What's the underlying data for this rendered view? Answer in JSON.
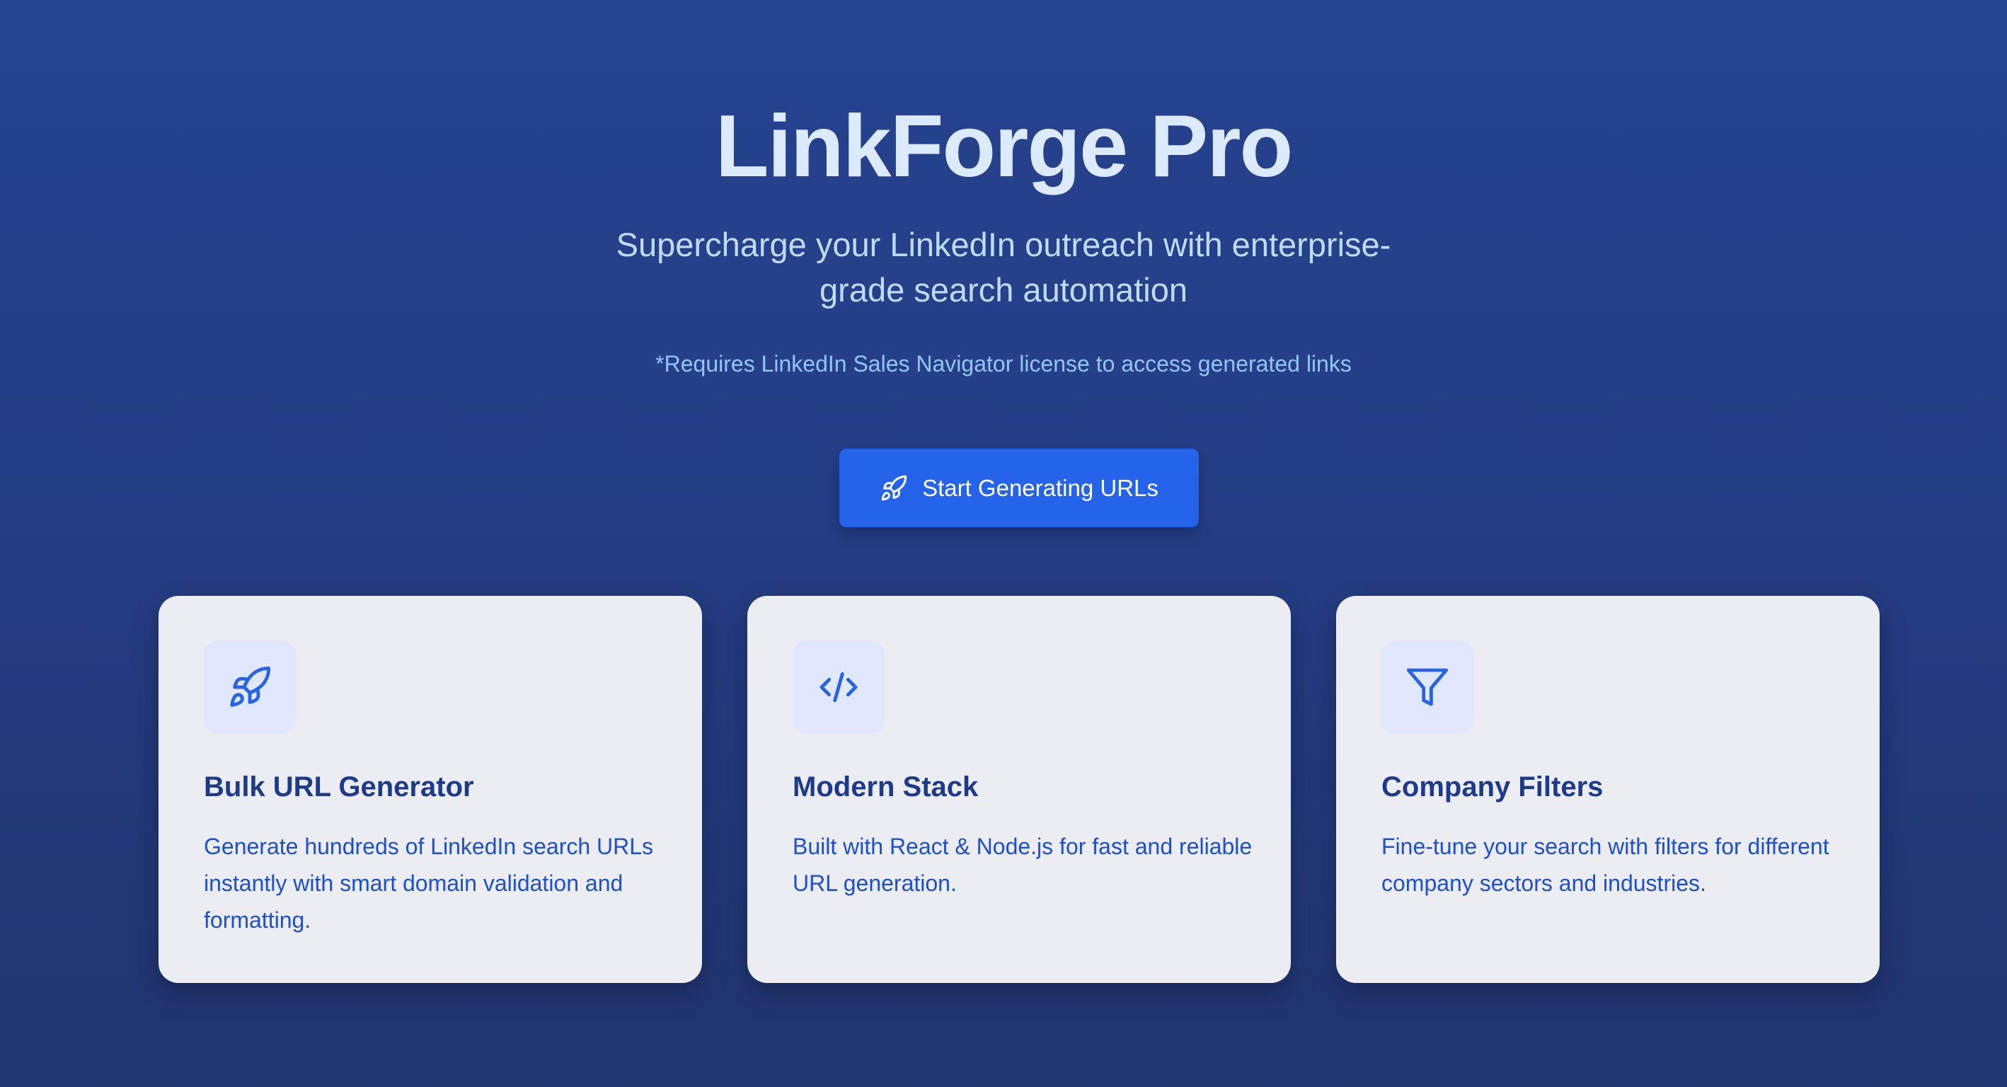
{
  "hero": {
    "title": "LinkForge Pro",
    "subtitle": "Supercharge your LinkedIn outreach with enterprise-grade search automation",
    "note": "*Requires LinkedIn Sales Navigator license to access generated links"
  },
  "cta": {
    "label": "Start Generating URLs",
    "icon": "rocket-icon"
  },
  "features": [
    {
      "icon": "rocket-icon",
      "title": "Bulk URL Generator",
      "description": "Generate hundreds of LinkedIn search URLs instantly with smart domain validation and formatting."
    },
    {
      "icon": "code-icon",
      "title": "Modern Stack",
      "description": "Built with React & Node.js for fast and reliable URL generation."
    },
    {
      "icon": "filter-icon",
      "title": "Company Filters",
      "description": "Fine-tune your search with filters for different company sectors and industries."
    }
  ],
  "colors": {
    "background": "#27428f",
    "accent": "#2563eb",
    "title": "#dbeafe",
    "card": "#ebedf3",
    "card_title": "#1e3a8a",
    "card_text": "#1d4ed8"
  }
}
